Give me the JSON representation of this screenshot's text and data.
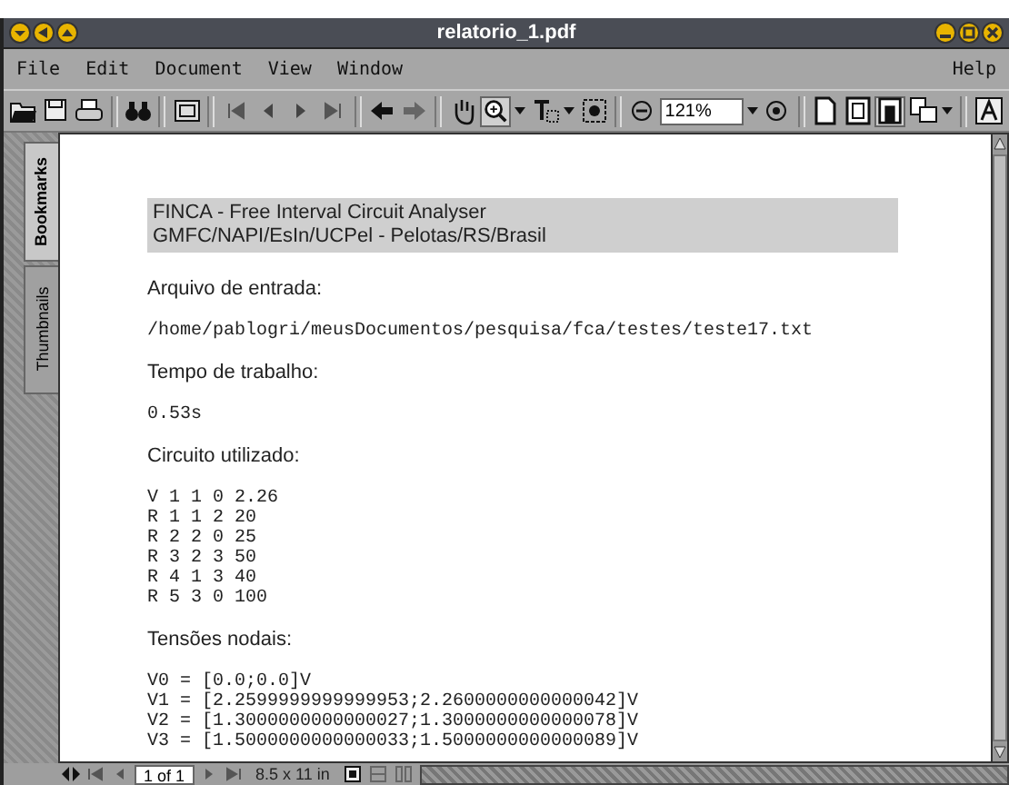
{
  "window": {
    "title": "relatorio_1.pdf"
  },
  "menu": {
    "left": [
      "File",
      "Edit",
      "Document",
      "View",
      "Window"
    ],
    "right": [
      "Help"
    ]
  },
  "toolbar": [
    {
      "kind": "open",
      "pressed": false
    },
    {
      "kind": "save",
      "pressed": false
    },
    {
      "kind": "print",
      "pressed": false
    },
    {
      "kind": "sep"
    },
    {
      "kind": "find",
      "pressed": false
    },
    {
      "kind": "sep"
    },
    {
      "kind": "panel",
      "pressed": false
    },
    {
      "kind": "sep"
    },
    {
      "kind": "first",
      "pressed": false
    },
    {
      "kind": "prev",
      "pressed": false
    },
    {
      "kind": "next",
      "pressed": false
    },
    {
      "kind": "last",
      "pressed": false
    },
    {
      "kind": "sep"
    },
    {
      "kind": "back",
      "pressed": false
    },
    {
      "kind": "forward",
      "pressed": false
    },
    {
      "kind": "sep"
    },
    {
      "kind": "hand",
      "pressed": false
    },
    {
      "kind": "zoomtool",
      "pressed": true
    },
    {
      "kind": "caret",
      "pressed": false
    },
    {
      "kind": "text",
      "pressed": false
    },
    {
      "kind": "caret",
      "pressed": false
    },
    {
      "kind": "snapshot",
      "pressed": false
    },
    {
      "kind": "sep"
    },
    {
      "kind": "zoomout",
      "pressed": false
    },
    {
      "kind": "zoomfield",
      "value": "121%"
    },
    {
      "kind": "caret",
      "pressed": false
    },
    {
      "kind": "zoomin",
      "pressed": false
    },
    {
      "kind": "sep"
    },
    {
      "kind": "page",
      "pressed": false
    },
    {
      "kind": "fitpage",
      "pressed": false
    },
    {
      "kind": "fitwidth",
      "pressed": true
    },
    {
      "kind": "rotate",
      "pressed": false
    },
    {
      "kind": "caret",
      "pressed": false
    },
    {
      "kind": "sep"
    },
    {
      "kind": "acrobat",
      "pressed": false
    }
  ],
  "side_tabs": [
    {
      "label": "Bookmarks",
      "selected": true
    },
    {
      "label": "Thumbnails",
      "selected": false
    }
  ],
  "document": [
    {
      "kind": "header",
      "lines": [
        "FINCA - Free Interval Circuit Analyser",
        "GMFC/NAPI/EsIn/UCPel - Pelotas/RS/Brasil"
      ]
    },
    {
      "kind": "label",
      "lines": [
        "Arquivo de entrada:"
      ]
    },
    {
      "kind": "mono",
      "lines": [
        "/home/pablogri/meusDocumentos/pesquisa/fca/testes/teste17.txt"
      ]
    },
    {
      "kind": "label",
      "lines": [
        "Tempo de trabalho:"
      ]
    },
    {
      "kind": "mono",
      "lines": [
        "0.53s"
      ]
    },
    {
      "kind": "label",
      "lines": [
        "Circuito utilizado:"
      ]
    },
    {
      "kind": "mono",
      "lines": [
        "V 1 1 0 2.26",
        "R 1 1 2 20",
        "R 2 2 0 25",
        "R 3 2 3 50",
        "R 4 1 3 40",
        "R 5 3 0 100"
      ]
    },
    {
      "kind": "label",
      "lines": [
        "Tensões nodais:"
      ]
    },
    {
      "kind": "mono",
      "lines": [
        "V0 = [0.0;0.0]V",
        "V1 = [2.2599999999999953;2.2600000000000042]V",
        "V2 = [1.3000000000000027;1.3000000000000078]V",
        "V3 = [1.5000000000000033;1.5000000000000089]V"
      ]
    }
  ],
  "status_bar": {
    "page": "1 of 1",
    "size": "8.5 x 11 in"
  }
}
